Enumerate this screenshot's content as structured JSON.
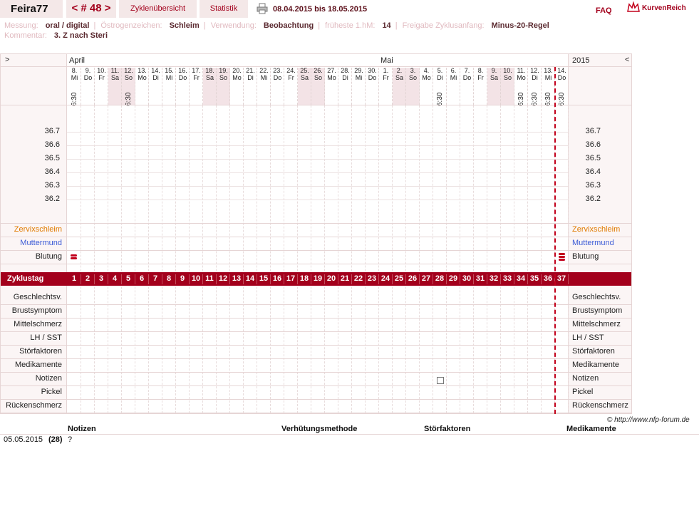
{
  "header": {
    "user": "Feira77",
    "cycle_nav": "< # 48 >",
    "tab_overview": "Zyklenübersicht",
    "tab_stats": "Statistik",
    "date_range": "08.04.2015 bis 18.05.2015",
    "faq": "FAQ",
    "logo": "KurvenReich"
  },
  "info": {
    "measure_label": "Messung:",
    "measure_value": "oral / digital",
    "estrogen_label": "Östrogenzeichen:",
    "estrogen_value": "Schleim",
    "usage_label": "Verwendung:",
    "usage_value": "Beobachtung",
    "early_label": "früheste 1.hM:",
    "early_value": "14",
    "release_label": "Freigabe Zyklusanfang:",
    "release_value": "Minus-20-Regel",
    "comment_label": "Kommentar:",
    "comment_value": "3. Z nach Steri"
  },
  "chart": {
    "nav_left": ">",
    "nav_right": "<",
    "month1": "April",
    "month2": "Mai",
    "year": "2015",
    "days": [
      {
        "d": "8.",
        "w": "Mi",
        "t": "6:30"
      },
      {
        "d": "9.",
        "w": "Do"
      },
      {
        "d": "10.",
        "w": "Fr"
      },
      {
        "d": "11.",
        "w": "Sa",
        "we": true
      },
      {
        "d": "12.",
        "w": "So",
        "we": true,
        "t": "6:30"
      },
      {
        "d": "13.",
        "w": "Mo"
      },
      {
        "d": "14.",
        "w": "Di"
      },
      {
        "d": "15.",
        "w": "Mi"
      },
      {
        "d": "16.",
        "w": "Do"
      },
      {
        "d": "17.",
        "w": "Fr"
      },
      {
        "d": "18.",
        "w": "Sa",
        "we": true
      },
      {
        "d": "19.",
        "w": "So",
        "we": true
      },
      {
        "d": "20.",
        "w": "Mo"
      },
      {
        "d": "21.",
        "w": "Di"
      },
      {
        "d": "22.",
        "w": "Mi"
      },
      {
        "d": "23.",
        "w": "Do"
      },
      {
        "d": "24.",
        "w": "Fr"
      },
      {
        "d": "25.",
        "w": "Sa",
        "we": true
      },
      {
        "d": "26.",
        "w": "So",
        "we": true
      },
      {
        "d": "27.",
        "w": "Mo"
      },
      {
        "d": "28.",
        "w": "Di"
      },
      {
        "d": "29.",
        "w": "Mi"
      },
      {
        "d": "30.",
        "w": "Do"
      },
      {
        "d": "1.",
        "w": "Fr"
      },
      {
        "d": "2.",
        "w": "Sa",
        "we": true
      },
      {
        "d": "3.",
        "w": "So",
        "we": true
      },
      {
        "d": "4.",
        "w": "Mo"
      },
      {
        "d": "5.",
        "w": "Di",
        "t": "6:30"
      },
      {
        "d": "6.",
        "w": "Mi"
      },
      {
        "d": "7.",
        "w": "Do"
      },
      {
        "d": "8.",
        "w": "Fr"
      },
      {
        "d": "9.",
        "w": "Sa",
        "we": true
      },
      {
        "d": "10.",
        "w": "So",
        "we": true
      },
      {
        "d": "11.",
        "w": "Mo",
        "t": "6:30"
      },
      {
        "d": "12.",
        "w": "Di",
        "t": "6:30"
      },
      {
        "d": "13.",
        "w": "Mi",
        "t": "6:30"
      },
      {
        "d": "14.",
        "w": "Do",
        "t": "6:30"
      }
    ],
    "temps": [
      "36.7",
      "36.6",
      "36.5",
      "36.4",
      "36.3",
      "36.2"
    ],
    "rows_colored": [
      {
        "label": "Zervixschleim",
        "color": "#e07b00"
      },
      {
        "label": "Muttermund",
        "color": "#3b5bd6"
      },
      {
        "label": "Blutung",
        "color": "#222222"
      }
    ],
    "cycle_label": "Zyklustag",
    "cycle_days": [
      "1",
      "2",
      "3",
      "4",
      "5",
      "6",
      "7",
      "8",
      "9",
      "10",
      "11",
      "12",
      "13",
      "14",
      "15",
      "16",
      "17",
      "18",
      "19",
      "20",
      "21",
      "22",
      "23",
      "24",
      "25",
      "26",
      "27",
      "28",
      "29",
      "30",
      "31",
      "32",
      "33",
      "34",
      "35",
      "36",
      "37"
    ],
    "rows_bottom": [
      "Geschlechtsv.",
      "Brustsymptom",
      "Mittelschmerz",
      "LH / SST",
      "Störfaktoren",
      "Medikamente",
      "Notizen",
      "Pickel",
      "Rückenschmerz"
    ]
  },
  "footer": {
    "copyright": "© http://www.nfp-forum.de",
    "col_notes": "Notizen",
    "col_method": "Verhütungsmethode",
    "col_disturb": "Störfaktoren",
    "col_meds": "Medikamente",
    "row_date": "05.05.2015",
    "row_day": "(28)",
    "row_note": "?"
  },
  "colors": {
    "accent": "#a3001c",
    "panel": "#fbf5f5",
    "weekend": "#f3e3e6"
  }
}
